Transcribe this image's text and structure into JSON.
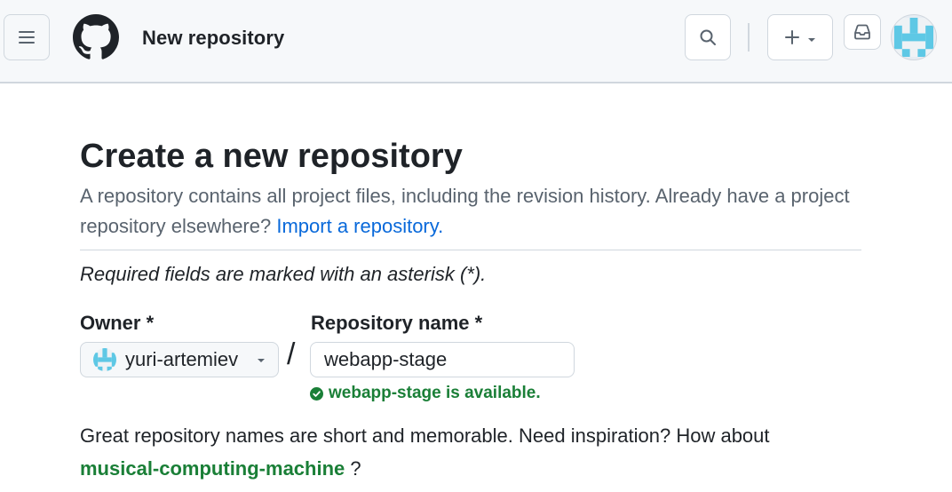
{
  "header": {
    "title": "New repository",
    "menu_icon": "hamburger-icon",
    "logo_icon": "github-logo-icon",
    "search_icon": "search-icon",
    "create_icon": "plus-icon",
    "inbox_icon": "inbox-icon"
  },
  "page": {
    "title": "Create a new repository",
    "description": "A repository contains all project files, including the revision history. Already have a project repository elsewhere?",
    "import_link": "Import a repository.",
    "required_note": "Required fields are marked with an asterisk (*)."
  },
  "form": {
    "owner_label": "Owner *",
    "owner_value": "yuri-artemiev",
    "slash": "/",
    "repo_label": "Repository name *",
    "repo_value": "webapp-stage",
    "availability": "webapp-stage is available."
  },
  "suggestion": {
    "text": "Great repository names are short and memorable. Need inspiration? How about",
    "name": "musical-computing-machine",
    "end": "?"
  },
  "colors": {
    "accent_link": "#0969da",
    "success": "#1a7f37",
    "avatar": "#5ec8e5"
  }
}
